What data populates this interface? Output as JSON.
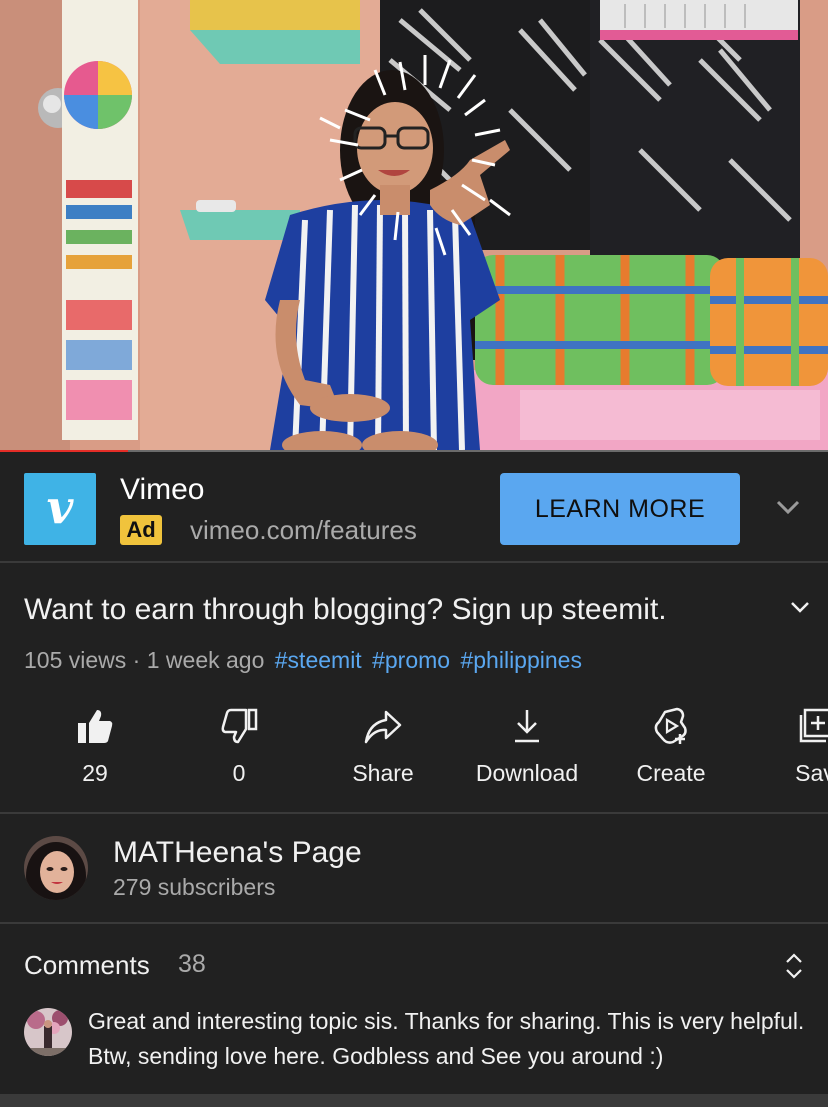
{
  "video": {
    "progress_fraction": 0.155
  },
  "ad": {
    "advertiser": "Vimeo",
    "logo_letter": "v",
    "badge": "Ad",
    "url": "vimeo.com/features",
    "cta": "LEARN MORE",
    "brand_color": "#3fb3e6",
    "cta_color": "#5aa7f0",
    "badge_color": "#f0c33c"
  },
  "video_info": {
    "title": "Want to earn through blogging? Sign up steemit.",
    "views": "105 views",
    "separator": "·",
    "age": "1 week ago",
    "hashtags": [
      "#steemit",
      "#promo",
      "#philippines"
    ]
  },
  "actions": [
    {
      "icon": "thumbs-up-icon",
      "label": "29"
    },
    {
      "icon": "thumbs-down-icon",
      "label": "0"
    },
    {
      "icon": "share-icon",
      "label": "Share"
    },
    {
      "icon": "download-icon",
      "label": "Download"
    },
    {
      "icon": "create-icon",
      "label": "Create"
    },
    {
      "icon": "save-icon",
      "label": "Sav"
    }
  ],
  "channel": {
    "name": "MATHeena's Page",
    "subscribers": "279 subscribers"
  },
  "comments": {
    "heading": "Comments",
    "count": "38",
    "top_comment": "Great and interesting topic sis. Thanks for sharing. This is very helpful. Btw, sending love here. Godbless and See you around :)"
  },
  "theme": {
    "background": "#212121",
    "link": "#5aa7f0",
    "progress": "#e52d27"
  }
}
